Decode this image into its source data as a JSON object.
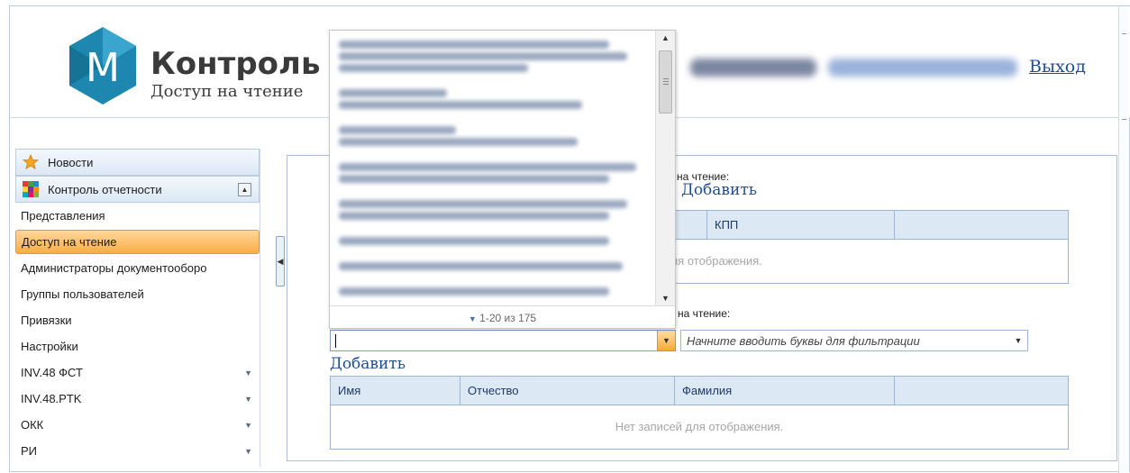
{
  "header": {
    "app_title": "Контроль о",
    "subtitle": "Доступ на чтение",
    "logout": "Выход",
    "logo_letter": "M"
  },
  "sidebar": {
    "news": "Новости",
    "reporting_control": "Контроль отчетности",
    "items": [
      {
        "label": "Представления",
        "arrow": false
      },
      {
        "label": "Доступ на чтение",
        "arrow": false,
        "active": true
      },
      {
        "label": "Администраторы документооборо",
        "arrow": false
      },
      {
        "label": "Группы пользователей",
        "arrow": false
      },
      {
        "label": "Привязки",
        "arrow": false
      },
      {
        "label": "Настройки",
        "arrow": false
      },
      {
        "label": "INV.48 ФСТ",
        "arrow": true
      },
      {
        "label": "INV.48.PTK",
        "arrow": true
      },
      {
        "label": "ОКК",
        "arrow": true
      },
      {
        "label": "РИ",
        "arrow": true
      }
    ]
  },
  "main": {
    "org_section_label": "на чтение:",
    "org_add": "Добавить",
    "org_grid": {
      "columns": [
        "",
        "КПП",
        ""
      ],
      "empty_text": "для отображения."
    },
    "user_section_label": "о на чтение:",
    "user_filter_placeholder": "Начните вводить буквы для фильтрации",
    "user_add": "Добавить",
    "user_grid": {
      "columns": [
        "Имя",
        "Отчество",
        "Фамилия",
        ""
      ],
      "empty_text": "Нет записей для отображения."
    }
  },
  "dropdown": {
    "pager": "1-20 из 175"
  },
  "colors": {
    "link": "#1f4e96",
    "grid_header": "#dde8f5",
    "active_item": "#f9ad46",
    "logo": "#1d87b0"
  }
}
